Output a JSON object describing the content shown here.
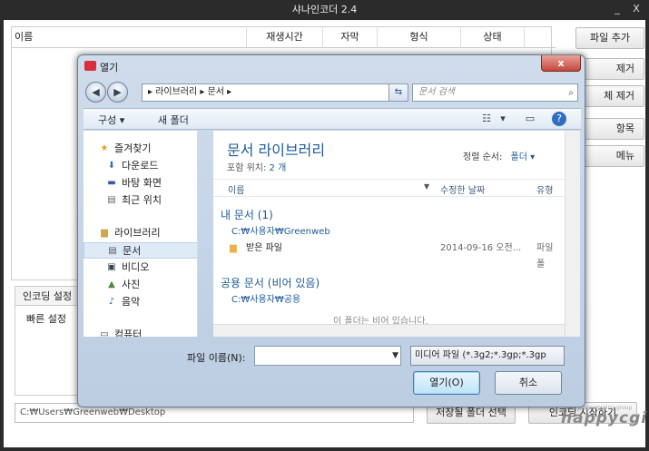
{
  "app": {
    "title": "샤나인코더 2.4",
    "minimize": "_",
    "close": "X",
    "columns": [
      "이름",
      "재생시간",
      "자막",
      "형식",
      "상태"
    ],
    "side_buttons": [
      "파일 추가",
      "제거",
      "체 제거",
      "항목",
      "메뉴"
    ],
    "tabs": [
      "인코딩 설정"
    ],
    "panel_label": "빠른 설정",
    "output_path": "C:₩Users₩Greenweb₩Desktop",
    "select_folder_button": "저장될 폴더 선택",
    "start_button": "인코딩 시작하기",
    "logo_text": "happycgi",
    "logo_tag": "web programming group"
  },
  "dialog": {
    "title": "열기",
    "close_glyph": "x",
    "address": "▸ 라이브러리 ▸ 문서 ▸",
    "search_placeholder": "문서 검색",
    "toolbar": {
      "organize": "구성 ▾",
      "new_folder": "새 폴더"
    },
    "nav": {
      "favorites": "즐겨찾기",
      "downloads": "다운로드",
      "desktop": "바탕 화면",
      "recent": "최근 위치",
      "libraries": "라이브러리",
      "documents": "문서",
      "videos": "비디오",
      "pictures": "사진",
      "music": "음악",
      "computer": "컴퓨터"
    },
    "library_title": "문서 라이브러리",
    "includes_label": "포함 위치:",
    "includes_count": "2 개",
    "sort_label": "정렬 순서:",
    "sort_value": "폴더 ▾",
    "col_name": "이름",
    "col_modified": "수정한 날짜",
    "col_type": "유형",
    "group_mine": "내 문서 (1)",
    "group_mine_path": "C:₩사용자₩Greenweb",
    "file_name": "받은 파일",
    "file_date": "2014-09-16 오전...",
    "file_type": "파일 폴",
    "group_public": "공용 문서 (비어 있음)",
    "group_public_path": "C:₩사용자₩공용",
    "empty_text": "이 폴더는 비어 있습니다.",
    "filename_label": "파일 이름(N):",
    "filename_value": "",
    "filetype_value": "미디어 파일 (*.3g2;*.3gp;*.3gp",
    "open_button": "열기(O)",
    "cancel_button": "취소"
  }
}
